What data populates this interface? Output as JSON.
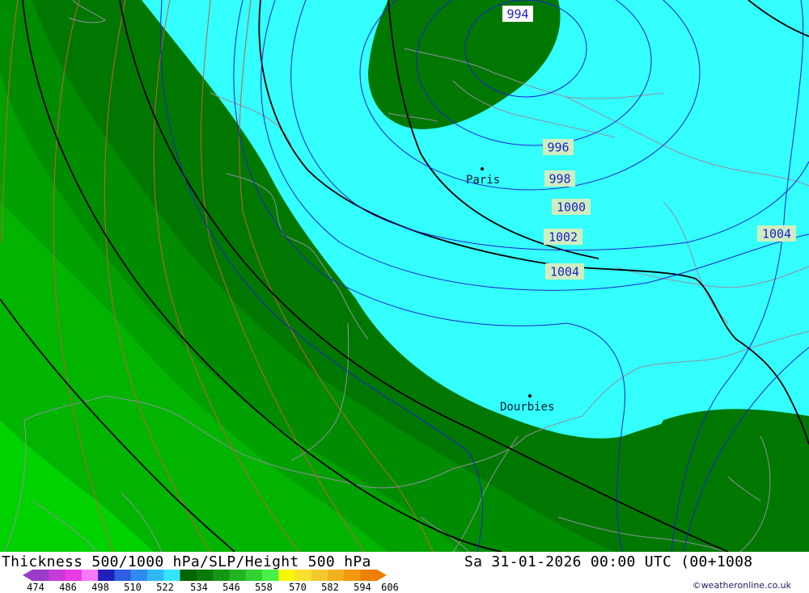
{
  "title": "Thickness 500/1000 hPa/SLP/Height 500 hPa",
  "datetime": "Sa 31-01-2026 00:00 UTC (00+1008",
  "credit": "©weatheronline.co.uk",
  "cities": [
    {
      "name": "Paris"
    },
    {
      "name": "Dourbies"
    }
  ],
  "isobar_labels": [
    "994",
    "996",
    "998",
    "1000",
    "1002",
    "1004",
    "1004"
  ],
  "legend": {
    "ticks": [
      "474",
      "486",
      "498",
      "510",
      "522",
      "534",
      "546",
      "558",
      "570",
      "582",
      "594",
      "606"
    ],
    "colors": [
      "#9b3bc7",
      "#c63bd6",
      "#e83be8",
      "#f57af5",
      "#2020b8",
      "#2d5fe0",
      "#2e8cf0",
      "#2fb8f5",
      "#35e4ff",
      "#006400",
      "#0a7a0a",
      "#149614",
      "#22b422",
      "#32d232",
      "#46f046",
      "#f7f700",
      "#f7e030",
      "#f5c830",
      "#f2b020",
      "#f09810",
      "#ee8000"
    ]
  },
  "colors": {
    "thickness_cyan": "#33ffff",
    "thickness_dark_green": "#007800",
    "thickness_green_1": "#008c00",
    "thickness_green_2": "#00a000",
    "thickness_green_3": "#00b400",
    "thickness_green_4": "#00d200",
    "isobar": "#2020d0",
    "height_contour": "#000000",
    "thickness_contour": "#c06040",
    "border": "#9090a0"
  }
}
